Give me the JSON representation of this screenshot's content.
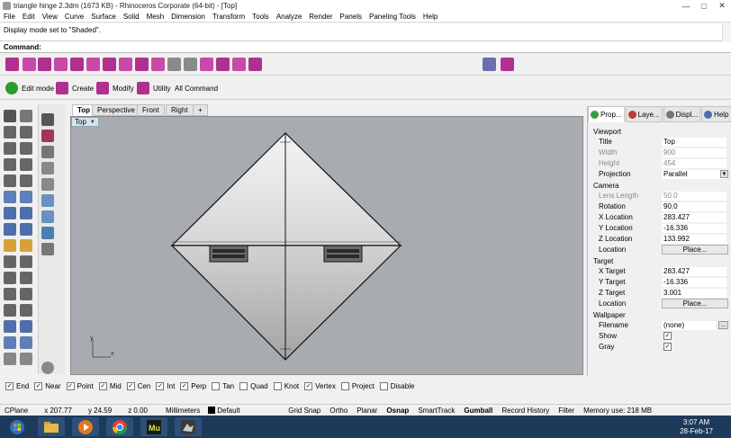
{
  "window": {
    "title": "triangle hinge 2.3dm (1673 KB) - Rhinoceros Corporate (64-bit) - [Top]",
    "controls": [
      "—",
      "□",
      "✕"
    ]
  },
  "menu": [
    "File",
    "Edit",
    "View",
    "Curve",
    "Surface",
    "Solid",
    "Mesh",
    "Dimension",
    "Transform",
    "Tools",
    "Analyze",
    "Render",
    "Panels",
    "Paneling Tools",
    "Help"
  ],
  "command": {
    "history": "Display mode set to \"Shaded\".",
    "prompt_label": "Command:"
  },
  "toolbar_tabs": [
    {
      "label": "Edit mode",
      "icon": "edit-mode-icon",
      "color": "#2a9d2a"
    },
    {
      "label": "Create",
      "icon": "create-icon",
      "color": "#b0308f"
    },
    {
      "label": "Modify",
      "icon": "modify-icon",
      "color": "#b0308f"
    },
    {
      "label": "Utility",
      "icon": "utility-icon",
      "color": "#b0308f"
    },
    {
      "label": "All Command",
      "icon": "",
      "color": ""
    }
  ],
  "viewport_tabs": [
    "Top",
    "Perspective",
    "Front",
    "Right",
    "+"
  ],
  "viewport": {
    "label": "Top",
    "axis_x": "x",
    "axis_y": "y",
    "background": "#a8abaf"
  },
  "panel_tabs": [
    "Prop...",
    "Laye...",
    "Displ...",
    "Help"
  ],
  "properties": {
    "viewport_section": "Viewport",
    "title": {
      "label": "Title",
      "value": "Top"
    },
    "width": {
      "label": "Width",
      "value": "900"
    },
    "height": {
      "label": "Height",
      "value": "454"
    },
    "projection": {
      "label": "Projection",
      "value": "Parallel"
    },
    "camera_section": "Camera",
    "lens_length": {
      "label": "Lens Length",
      "value": "50.0"
    },
    "rotation": {
      "label": "Rotation",
      "value": "90.0"
    },
    "x_location": {
      "label": "X Location",
      "value": "283.427"
    },
    "y_location": {
      "label": "Y Location",
      "value": "-16.336"
    },
    "z_location": {
      "label": "Z Location",
      "value": "133.992"
    },
    "location": {
      "label": "Location",
      "button": "Place..."
    },
    "target_section": "Target",
    "x_target": {
      "label": "X Target",
      "value": "283.427"
    },
    "y_target": {
      "label": "Y Target",
      "value": "-16.336"
    },
    "z_target": {
      "label": "Z Target",
      "value": "3.001"
    },
    "target_location": {
      "label": "Location",
      "button": "Place..."
    },
    "wallpaper_section": "Wallpaper",
    "filename": {
      "label": "Filename",
      "value": "(none)",
      "button": "..."
    },
    "show": {
      "label": "Show",
      "checked": true
    },
    "gray": {
      "label": "Gray",
      "checked": true
    }
  },
  "osnaps": [
    {
      "label": "End",
      "checked": true
    },
    {
      "label": "Near",
      "checked": true
    },
    {
      "label": "Point",
      "checked": true
    },
    {
      "label": "Mid",
      "checked": true
    },
    {
      "label": "Cen",
      "checked": true
    },
    {
      "label": "Int",
      "checked": true
    },
    {
      "label": "Perp",
      "checked": true
    },
    {
      "label": "Tan",
      "checked": false
    },
    {
      "label": "Quad",
      "checked": false
    },
    {
      "label": "Knot",
      "checked": false
    },
    {
      "label": "Vertex",
      "checked": true
    },
    {
      "label": "Project",
      "checked": false
    },
    {
      "label": "Disable",
      "checked": false
    }
  ],
  "status": {
    "cplane": "CPlane",
    "x": "x 207.77",
    "y": "y 24.59",
    "z": "z 0.00",
    "units": "Millimeters",
    "layer": "Default",
    "toggles": [
      "Grid Snap",
      "Ortho",
      "Planar",
      "Osnap",
      "SmartTrack",
      "Gumball",
      "Record History",
      "Filter"
    ],
    "bold_toggles": [
      "Osnap",
      "Gumball"
    ],
    "memory": "Memory use: 218 MB"
  },
  "taskbar": {
    "time": "3:07 AM",
    "date": "28-Feb-17",
    "apps": [
      "start-icon",
      "explorer-icon",
      "media-player-icon",
      "chrome-icon",
      "muse-icon",
      "rhino-icon"
    ]
  },
  "colors": {
    "accent_magenta": "#b0308f",
    "accent_green": "#2a9d2a",
    "taskbar": "#1d3a5a"
  }
}
